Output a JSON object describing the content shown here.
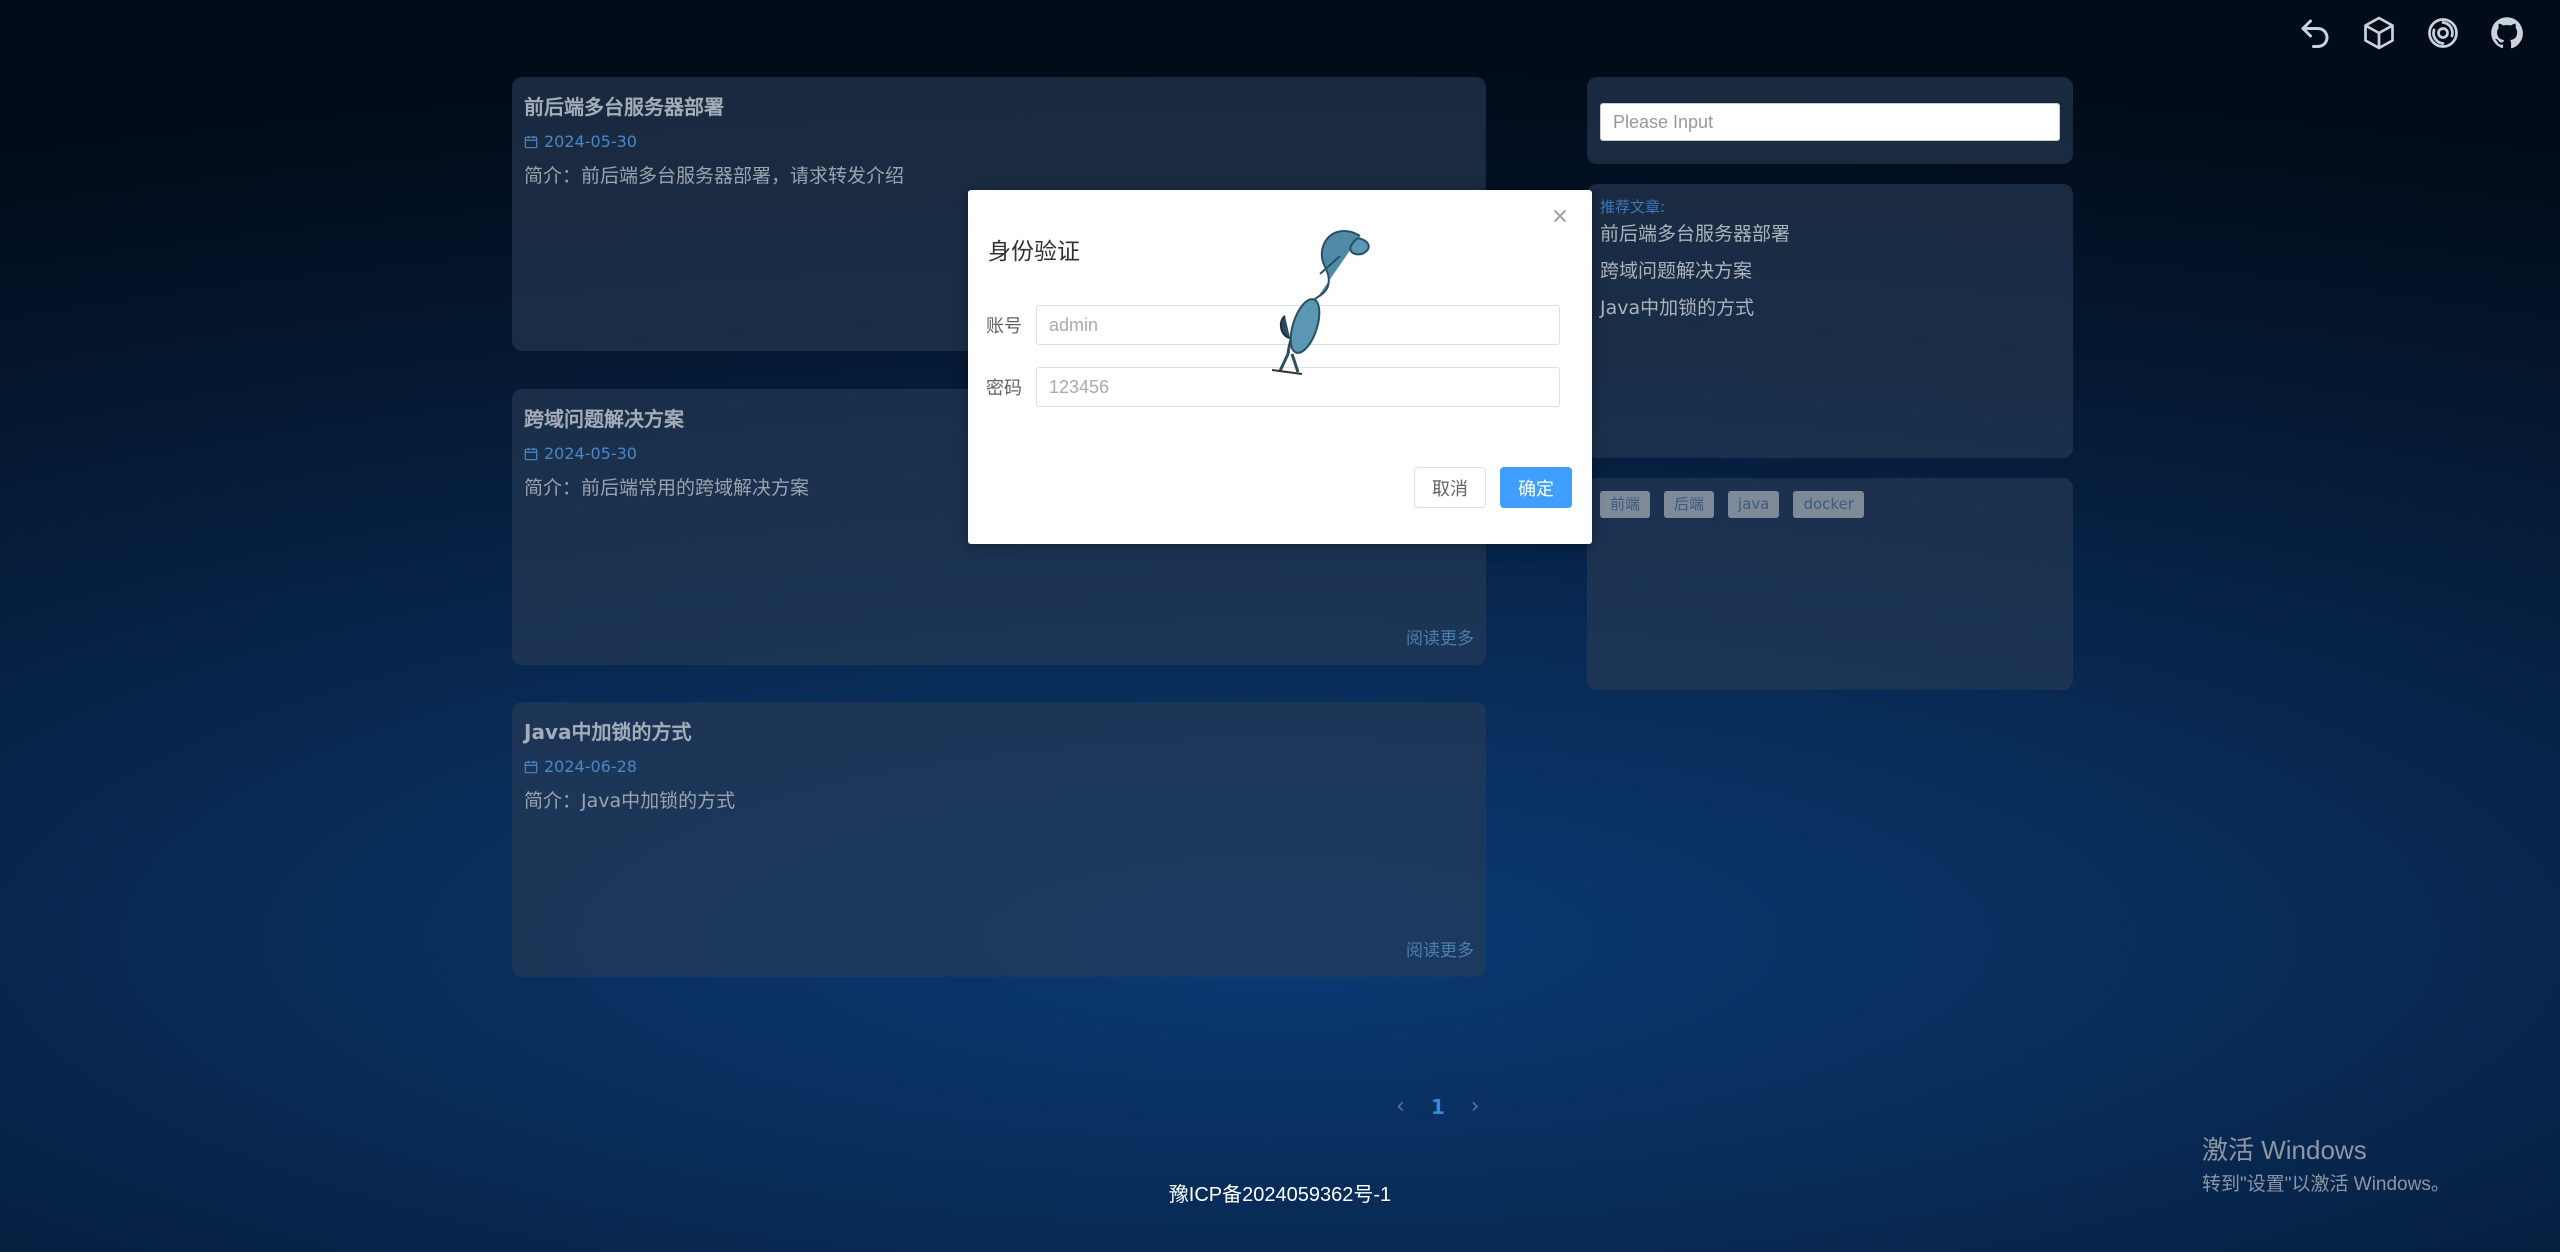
{
  "topbar": {
    "icons": [
      "back-icon",
      "cube-icon",
      "swirl-icon",
      "github-icon"
    ]
  },
  "articles": [
    {
      "title": "前后端多台服务器部署",
      "date": "2024-05-30",
      "summary": "简介：前后端多台服务器部署，请求转发介绍",
      "read_more": ""
    },
    {
      "title": "跨域问题解决方案",
      "date": "2024-05-30",
      "summary": "简介：前后端常用的跨域解决方案",
      "read_more": "阅读更多"
    },
    {
      "title": "Java中加锁的方式",
      "date": "2024-06-28",
      "summary": "简介：Java中加锁的方式",
      "read_more": "阅读更多"
    }
  ],
  "sidebar": {
    "search_placeholder": "Please Input",
    "recommend_title": "推荐文章:",
    "recommend": [
      "前后端多台服务器部署",
      "跨域问题解决方案",
      "Java中加锁的方式"
    ],
    "tags": [
      "前端",
      "后端",
      "java",
      "docker"
    ]
  },
  "pagination": {
    "prev": "‹",
    "current": "1",
    "next": "›"
  },
  "footer": {
    "icp": "豫ICP备2024059362号-1"
  },
  "watermark": {
    "line1": "激活 Windows",
    "line2": "转到\"设置\"以激活 Windows。"
  },
  "dialog": {
    "title": "身份验证",
    "account_label": "账号",
    "account_placeholder": "admin",
    "password_label": "密码",
    "password_placeholder": "123456",
    "cancel": "取消",
    "confirm": "确定"
  }
}
